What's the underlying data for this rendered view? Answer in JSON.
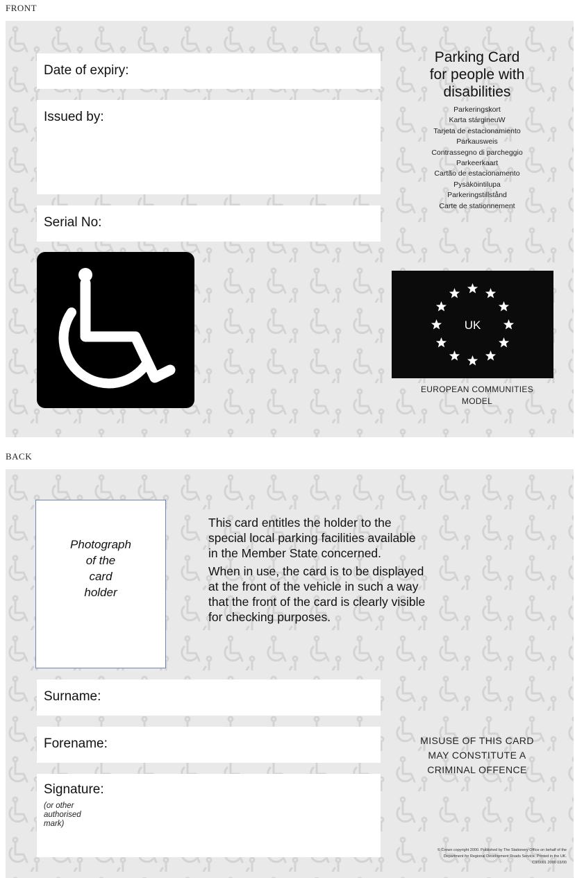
{
  "front": {
    "section_label": "FRONT",
    "fields": {
      "expiry": "Date of expiry:",
      "issued_by": "Issued by:",
      "serial": "Serial No:"
    },
    "title_lines": [
      "Parking Card",
      "for people with",
      "disabilities"
    ],
    "translations": [
      "Parkeringskort",
      "Karta stárgineuW",
      "Tarjeta de estacionamiento",
      "Parkausweis",
      "Contrassegno di parcheggio",
      "Parkeerkaart",
      "Cartão de estacionamento",
      "Pysäköintilupa",
      "Parkeringstillstånd",
      "Carte de stationnement"
    ],
    "flag_code": "UK",
    "model_caption_lines": [
      "EUROPEAN COMMUNITIES",
      "MODEL"
    ],
    "symbol_icon": "wheelchair-icon",
    "star_icon": "star-icon"
  },
  "back": {
    "section_label": "BACK",
    "photo_lines": [
      "Photograph",
      "of the",
      "card",
      "holder"
    ],
    "entitlement_p1": [
      "This card entitles the holder to the",
      "special local parking facilities available",
      "in the Member State concerned."
    ],
    "entitlement_p2": [
      "When in use, the card is to be displayed",
      "at the front of the vehicle in such a way",
      "that the front of the card is clearly visible",
      "for checking purposes."
    ],
    "fields": {
      "surname": "Surname:",
      "forename": "Forename:",
      "signature": "Signature:",
      "signature_note_lines": [
        "(or other",
        "authorised",
        "mark)"
      ]
    },
    "misuse_lines": [
      "MISUSE OF THIS CARD",
      "MAY CONSTITUTE A",
      "CRIMINAL OFFENCE"
    ],
    "copyright_lines": [
      "© Crown copyright 2000. Published by The Stationery Office on behalf of the",
      "Department for Regional Development Roads Service. Printed in the UK.",
      "C3/0001 2000 03/00"
    ]
  },
  "colors": {
    "card_background": "#e9e9e9",
    "pattern_stroke": "#d3d3d3",
    "photo_border": "#6b86b8",
    "symbol_background": "#000000"
  }
}
